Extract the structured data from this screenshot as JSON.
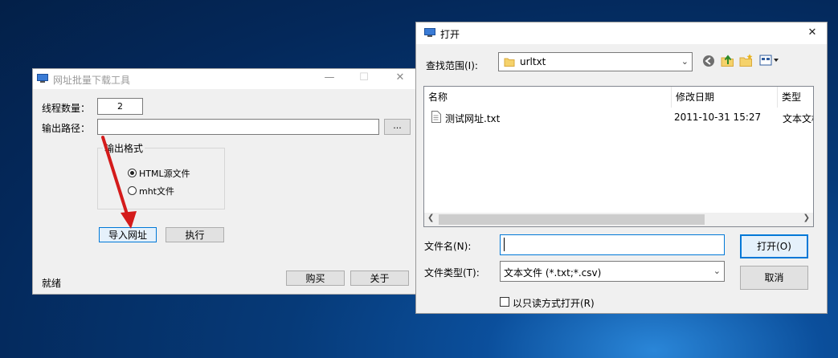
{
  "tool_window": {
    "title": "网址批量下载工具",
    "minimize": "—",
    "maximize": "☐",
    "close": "✕",
    "thread_label": "线程数量：",
    "thread_value": "2",
    "output_path_label": "输出路径：",
    "output_path_value": "",
    "browse_label": "...",
    "format_group_label": "输出格式",
    "format_options": [
      "HTML源文件",
      "mht文件"
    ],
    "selected_format": "HTML源文件",
    "import_button": "导入网址",
    "run_button": "执行",
    "buy_button": "购买",
    "about_button": "关于",
    "status": "就绪"
  },
  "open_dialog": {
    "title": "打开",
    "close": "✕",
    "look_in_label": "查找范围(I):",
    "look_in_value": "urltxt",
    "columns": [
      "名称",
      "修改日期",
      "类型"
    ],
    "files": [
      {
        "name": "测试网址.txt",
        "date": "2011-10-31 15:27",
        "type": "文本文档"
      }
    ],
    "filename_label": "文件名(N):",
    "filename_value": "",
    "filetype_label": "文件类型(T):",
    "filetype_value": "文本文件 (*.txt;*.csv)",
    "open_button": "打开(O)",
    "cancel_button": "取消",
    "readonly_label": "以只读方式打开(R)",
    "readonly_checked": false
  },
  "colors": {
    "desktop": "#063a78",
    "window_bg": "#f0f0f0",
    "focus_blue": "#0078d7",
    "arrow_red": "#d41b1b",
    "folder_yellow": "#f5d26b"
  },
  "icons": [
    "app-icon",
    "folder-icon",
    "back-icon",
    "up-folder-icon",
    "new-folder-icon",
    "view-menu-icon",
    "text-file-icon"
  ]
}
